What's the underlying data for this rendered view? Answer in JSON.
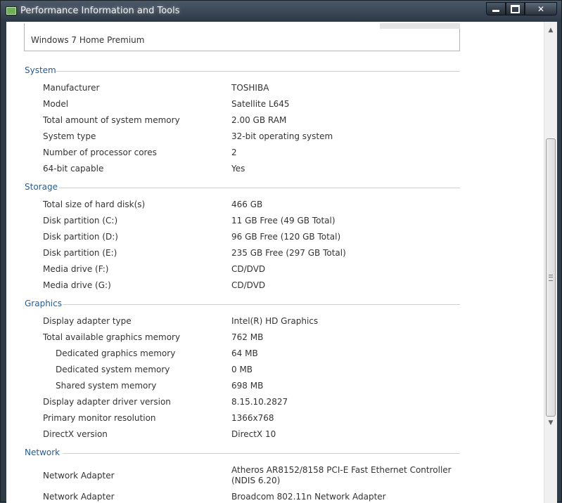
{
  "window": {
    "title": "Performance Information and Tools"
  },
  "edition": "Windows 7 Home Premium",
  "sections": {
    "system": {
      "title": "System",
      "rows": [
        {
          "label": "Manufacturer",
          "value": "TOSHIBA"
        },
        {
          "label": "Model",
          "value": "Satellite L645"
        },
        {
          "label": "Total amount of system memory",
          "value": "2.00 GB RAM"
        },
        {
          "label": "System type",
          "value": "32-bit operating system"
        },
        {
          "label": "Number of processor cores",
          "value": "2"
        },
        {
          "label": "64-bit capable",
          "value": "Yes"
        }
      ]
    },
    "storage": {
      "title": "Storage",
      "rows": [
        {
          "label": "Total size of hard disk(s)",
          "value": "466 GB"
        },
        {
          "label": "Disk partition (C:)",
          "value": "11 GB Free (49 GB Total)"
        },
        {
          "label": "Disk partition (D:)",
          "value": "96 GB Free (120 GB Total)"
        },
        {
          "label": "Disk partition (E:)",
          "value": "235 GB Free (297 GB Total)"
        },
        {
          "label": "Media drive (F:)",
          "value": "CD/DVD"
        },
        {
          "label": "Media drive (G:)",
          "value": "CD/DVD"
        }
      ]
    },
    "graphics": {
      "title": "Graphics",
      "rows": [
        {
          "label": "Display adapter type",
          "value": "Intel(R) HD Graphics"
        },
        {
          "label": "Total available graphics memory",
          "value": "762 MB"
        },
        {
          "label": "Dedicated graphics memory",
          "value": "64 MB"
        },
        {
          "label": "Dedicated system memory",
          "value": "0 MB"
        },
        {
          "label": "Shared system memory",
          "value": "698 MB"
        },
        {
          "label": "Display adapter driver version",
          "value": "8.15.10.2827"
        },
        {
          "label": "Primary monitor resolution",
          "value": "1366x768"
        },
        {
          "label": "DirectX version",
          "value": "DirectX 10"
        }
      ]
    },
    "network": {
      "title": "Network",
      "rows": [
        {
          "label": "Network Adapter",
          "value": "Atheros AR8152/8158 PCI-E Fast Ethernet Controller (NDIS 6.20)"
        },
        {
          "label": "Network Adapter",
          "value": "Broadcom 802.11n Network Adapter"
        }
      ]
    }
  }
}
